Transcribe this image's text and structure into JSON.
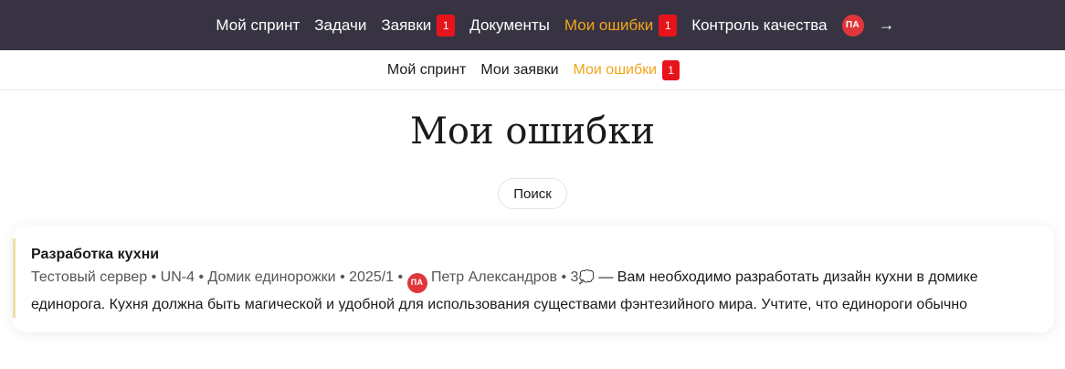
{
  "topnav": {
    "items": [
      {
        "label": "Мой спринт"
      },
      {
        "label": "Задачи"
      },
      {
        "label": "Заявки",
        "badge": "1"
      },
      {
        "label": "Документы"
      },
      {
        "label": "Мои ошибки",
        "badge": "1",
        "active": true
      },
      {
        "label": "Контроль качества"
      }
    ],
    "avatar": "ПА",
    "logout_icon": "→"
  },
  "subnav": {
    "items": [
      {
        "label": "Мой спринт"
      },
      {
        "label": "Мои заявки"
      },
      {
        "label": "Мои ошибки",
        "badge": "1",
        "active": true
      }
    ]
  },
  "page": {
    "title": "Мои ошибки",
    "search_label": "Поиск"
  },
  "bug": {
    "title": "Разработка кухни",
    "server": "Тестовый сервер",
    "key": "UN-4",
    "project": "Домик единорожки",
    "version": "2025/1",
    "assignee_initials": "ПА",
    "assignee": "Петр Александров",
    "comments": "3",
    "description": "Вам необходимо разработать дизайн кухни в домике единорога. Кухня должна быть магической и удобной для использования существами фэнтезийного мира. Учтите, что единороги обычно"
  },
  "icons": {
    "logout": "arrow-right-icon",
    "comments": "speech-bubble-icon"
  },
  "colors": {
    "topbar_bg": "#383342",
    "accent": "#f2a51a",
    "badge": "#e8141c",
    "avatar": "#e0363b",
    "card_border": "#f0dfa8"
  }
}
